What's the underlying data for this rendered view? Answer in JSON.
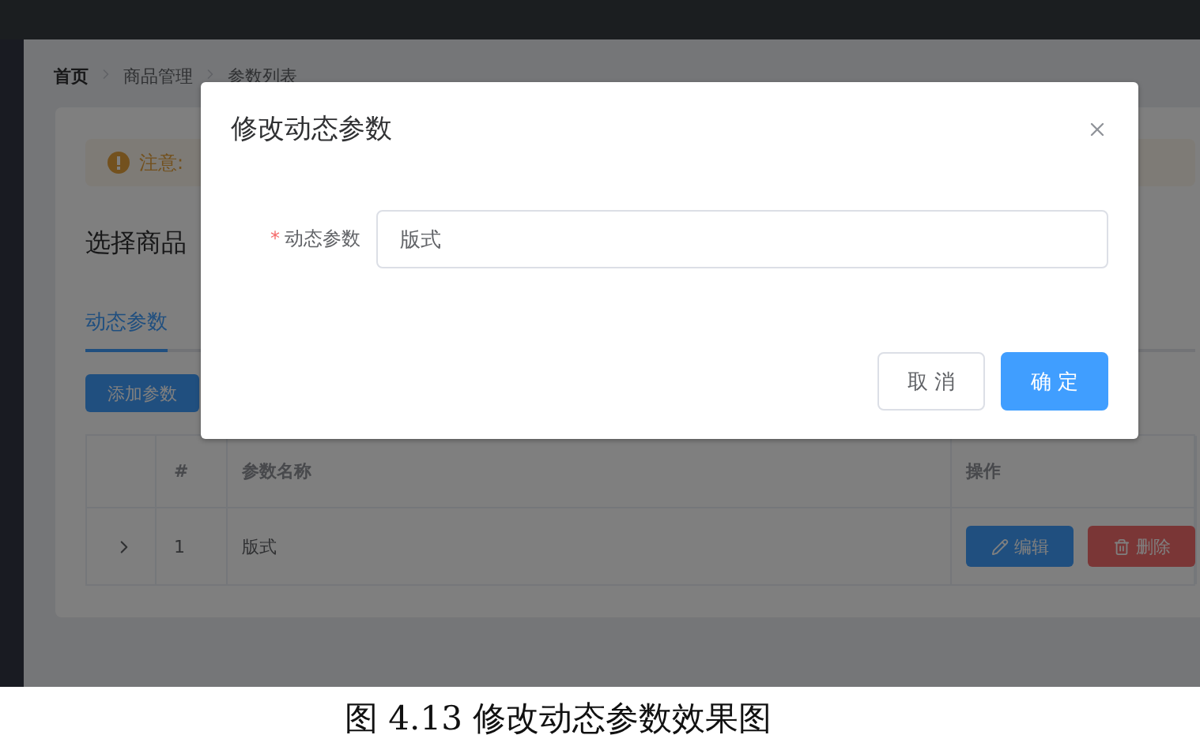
{
  "breadcrumb": [
    "首页",
    "商品管理",
    "参数列表"
  ],
  "alert": {
    "text": "注意:"
  },
  "card_title": "选择商品",
  "tabs": [
    {
      "label": "动态参数",
      "selected": true
    }
  ],
  "add_button": "添加参数",
  "table": {
    "columns": [
      "#",
      "参数名称",
      "操作"
    ],
    "rows": [
      {
        "expanded": false,
        "index": "1",
        "name": "版式",
        "actions": [
          {
            "label": "编辑",
            "kind": "edit"
          },
          {
            "label": "删除",
            "kind": "delete"
          }
        ]
      }
    ]
  },
  "dialog": {
    "title": "修改动态参数",
    "field": {
      "required_mark": "*",
      "label": "动态参数",
      "value": "版式"
    },
    "buttons": [
      {
        "label": "取 消",
        "kind": "default"
      },
      {
        "label": "确 定",
        "kind": "primary"
      }
    ]
  },
  "caption": "图 4.13 修改动态参数效果图"
}
